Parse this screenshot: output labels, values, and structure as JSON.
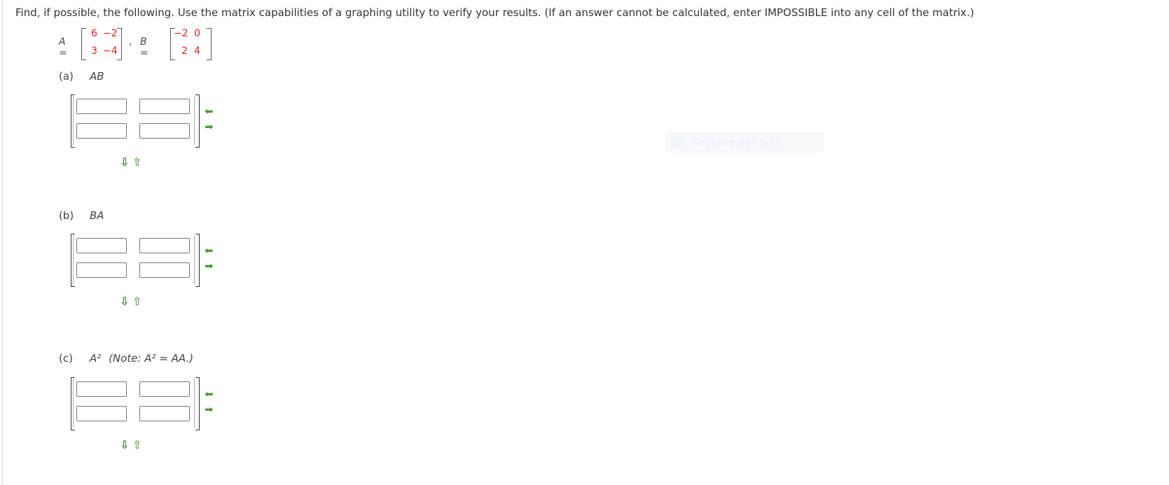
{
  "instructions": "Find, if possible, the following. Use the matrix capabilities of a graphing utility to verify your results. (If an answer cannot be calculated, enter IMPOSSIBLE into any cell of the matrix.)",
  "given": {
    "a_label": "A =",
    "a_values": [
      [
        "6",
        "−2"
      ],
      [
        "3",
        "−4"
      ]
    ],
    "separator": ",",
    "b_label": "B =",
    "b_values": [
      [
        "−2",
        "0"
      ],
      [
        "2",
        "4"
      ]
    ]
  },
  "parts": [
    {
      "tag": "(a)",
      "expr": "AB",
      "note": ""
    },
    {
      "tag": "(b)",
      "expr": "BA",
      "note": ""
    },
    {
      "tag": "(c)",
      "expr": "A²",
      "note": "(Note: A² = AA.)"
    }
  ],
  "overlay": {
    "text": "Rectangular Snip"
  },
  "colors": {
    "given_values": "#dd2222",
    "arrow_green": "#4a9a3a"
  },
  "icons": {
    "add_column": "left-arrow-icon",
    "remove_column": "right-arrow-icon",
    "add_row": "down-arrow-icon",
    "remove_row": "up-arrow-icon"
  }
}
